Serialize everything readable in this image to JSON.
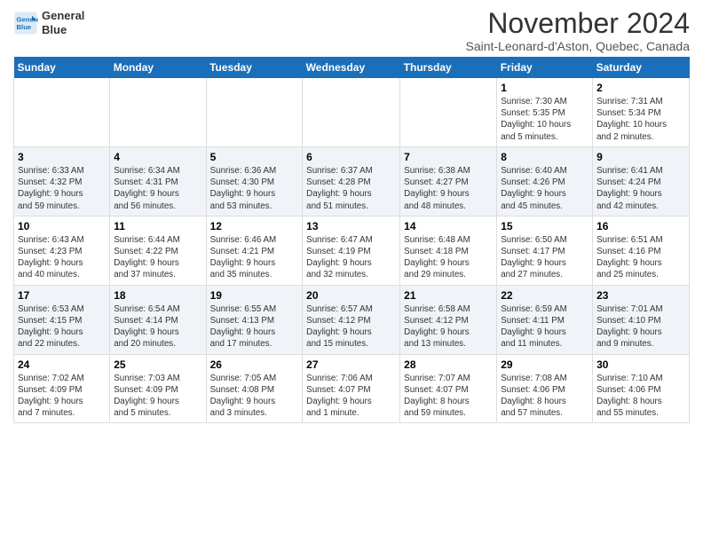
{
  "header": {
    "logo_line1": "General",
    "logo_line2": "Blue",
    "title": "November 2024",
    "subtitle": "Saint-Leonard-d'Aston, Quebec, Canada"
  },
  "weekdays": [
    "Sunday",
    "Monday",
    "Tuesday",
    "Wednesday",
    "Thursday",
    "Friday",
    "Saturday"
  ],
  "weeks": [
    [
      {
        "day": "",
        "info": ""
      },
      {
        "day": "",
        "info": ""
      },
      {
        "day": "",
        "info": ""
      },
      {
        "day": "",
        "info": ""
      },
      {
        "day": "",
        "info": ""
      },
      {
        "day": "1",
        "info": "Sunrise: 7:30 AM\nSunset: 5:35 PM\nDaylight: 10 hours\nand 5 minutes."
      },
      {
        "day": "2",
        "info": "Sunrise: 7:31 AM\nSunset: 5:34 PM\nDaylight: 10 hours\nand 2 minutes."
      }
    ],
    [
      {
        "day": "3",
        "info": "Sunrise: 6:33 AM\nSunset: 4:32 PM\nDaylight: 9 hours\nand 59 minutes."
      },
      {
        "day": "4",
        "info": "Sunrise: 6:34 AM\nSunset: 4:31 PM\nDaylight: 9 hours\nand 56 minutes."
      },
      {
        "day": "5",
        "info": "Sunrise: 6:36 AM\nSunset: 4:30 PM\nDaylight: 9 hours\nand 53 minutes."
      },
      {
        "day": "6",
        "info": "Sunrise: 6:37 AM\nSunset: 4:28 PM\nDaylight: 9 hours\nand 51 minutes."
      },
      {
        "day": "7",
        "info": "Sunrise: 6:38 AM\nSunset: 4:27 PM\nDaylight: 9 hours\nand 48 minutes."
      },
      {
        "day": "8",
        "info": "Sunrise: 6:40 AM\nSunset: 4:26 PM\nDaylight: 9 hours\nand 45 minutes."
      },
      {
        "day": "9",
        "info": "Sunrise: 6:41 AM\nSunset: 4:24 PM\nDaylight: 9 hours\nand 42 minutes."
      }
    ],
    [
      {
        "day": "10",
        "info": "Sunrise: 6:43 AM\nSunset: 4:23 PM\nDaylight: 9 hours\nand 40 minutes."
      },
      {
        "day": "11",
        "info": "Sunrise: 6:44 AM\nSunset: 4:22 PM\nDaylight: 9 hours\nand 37 minutes."
      },
      {
        "day": "12",
        "info": "Sunrise: 6:46 AM\nSunset: 4:21 PM\nDaylight: 9 hours\nand 35 minutes."
      },
      {
        "day": "13",
        "info": "Sunrise: 6:47 AM\nSunset: 4:19 PM\nDaylight: 9 hours\nand 32 minutes."
      },
      {
        "day": "14",
        "info": "Sunrise: 6:48 AM\nSunset: 4:18 PM\nDaylight: 9 hours\nand 29 minutes."
      },
      {
        "day": "15",
        "info": "Sunrise: 6:50 AM\nSunset: 4:17 PM\nDaylight: 9 hours\nand 27 minutes."
      },
      {
        "day": "16",
        "info": "Sunrise: 6:51 AM\nSunset: 4:16 PM\nDaylight: 9 hours\nand 25 minutes."
      }
    ],
    [
      {
        "day": "17",
        "info": "Sunrise: 6:53 AM\nSunset: 4:15 PM\nDaylight: 9 hours\nand 22 minutes."
      },
      {
        "day": "18",
        "info": "Sunrise: 6:54 AM\nSunset: 4:14 PM\nDaylight: 9 hours\nand 20 minutes."
      },
      {
        "day": "19",
        "info": "Sunrise: 6:55 AM\nSunset: 4:13 PM\nDaylight: 9 hours\nand 17 minutes."
      },
      {
        "day": "20",
        "info": "Sunrise: 6:57 AM\nSunset: 4:12 PM\nDaylight: 9 hours\nand 15 minutes."
      },
      {
        "day": "21",
        "info": "Sunrise: 6:58 AM\nSunset: 4:12 PM\nDaylight: 9 hours\nand 13 minutes."
      },
      {
        "day": "22",
        "info": "Sunrise: 6:59 AM\nSunset: 4:11 PM\nDaylight: 9 hours\nand 11 minutes."
      },
      {
        "day": "23",
        "info": "Sunrise: 7:01 AM\nSunset: 4:10 PM\nDaylight: 9 hours\nand 9 minutes."
      }
    ],
    [
      {
        "day": "24",
        "info": "Sunrise: 7:02 AM\nSunset: 4:09 PM\nDaylight: 9 hours\nand 7 minutes."
      },
      {
        "day": "25",
        "info": "Sunrise: 7:03 AM\nSunset: 4:09 PM\nDaylight: 9 hours\nand 5 minutes."
      },
      {
        "day": "26",
        "info": "Sunrise: 7:05 AM\nSunset: 4:08 PM\nDaylight: 9 hours\nand 3 minutes."
      },
      {
        "day": "27",
        "info": "Sunrise: 7:06 AM\nSunset: 4:07 PM\nDaylight: 9 hours\nand 1 minute."
      },
      {
        "day": "28",
        "info": "Sunrise: 7:07 AM\nSunset: 4:07 PM\nDaylight: 8 hours\nand 59 minutes."
      },
      {
        "day": "29",
        "info": "Sunrise: 7:08 AM\nSunset: 4:06 PM\nDaylight: 8 hours\nand 57 minutes."
      },
      {
        "day": "30",
        "info": "Sunrise: 7:10 AM\nSunset: 4:06 PM\nDaylight: 8 hours\nand 55 minutes."
      }
    ]
  ]
}
